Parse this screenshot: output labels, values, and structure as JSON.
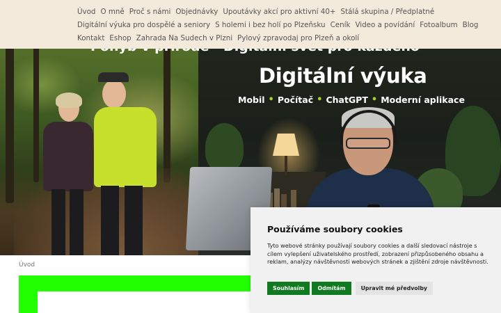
{
  "nav": {
    "row1": [
      "Úvod",
      "O mně",
      "Proč s námi",
      "Objednávky",
      "Upoutávky akcí pro aktivní 40+",
      "Stálá skupina / Předplatné"
    ],
    "row2": [
      "Digitální výuka pro dospělé a seniory",
      "S holemi i bez holí po Plzeňsku",
      "Ceník",
      "Video a povídání",
      "Fotoalbum",
      "Blog"
    ],
    "row3": [
      "Kontakt",
      "Eshop",
      "Zahrada Na Sudech v Plzni",
      "Pylový zpravodaj pro Plzeň a okolí"
    ]
  },
  "hero": {
    "top_text": "Pohyb v přírodě · Digitální svět pro každého",
    "title": "Digitální výuka",
    "subtitle": [
      "Mobil",
      "Počítač",
      "ChatGPT",
      "Moderní aplikace"
    ],
    "separator": "•"
  },
  "breadcrumb": "Úvod",
  "cookie": {
    "title": "Používáme soubory cookies",
    "text": "Tyto webové stránky používají soubory cookies a další sledovací nástroje s cílem vylepšení uživatelského prostředí, zobrazení přizpůsobeného obsahu a reklam, analýzy návštěvnosti webových stránek a zjištění zdroje návštěvnosti.",
    "accept": "Souhlasím",
    "reject": "Odmítám",
    "customize": "Upravit mé předvolby"
  },
  "colors": {
    "nav_bg": "#f4eadb",
    "accent_green": "#a7d22a",
    "button_green": "#0f7a1f",
    "placeholder_green": "#22ff00"
  }
}
